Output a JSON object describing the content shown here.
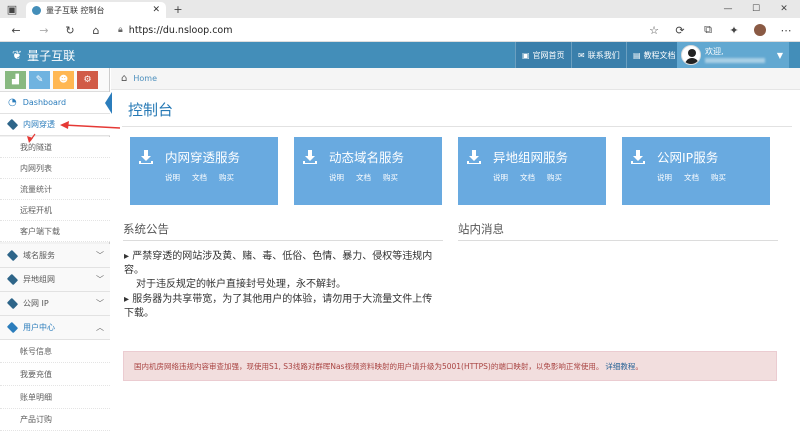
{
  "browser": {
    "tab_title": "量子互联 控制台",
    "url": "https://du.nsloop.com"
  },
  "navbar": {
    "brand": "量子互联",
    "links": [
      {
        "label": "官网首页",
        "icon": "monitor-icon"
      },
      {
        "label": "联系我们",
        "icon": "chat-icon"
      },
      {
        "label": "教程文档",
        "icon": "book-icon"
      }
    ],
    "user_greeting": "欢迎,"
  },
  "shortcuts": [
    {
      "icon": "signal-icon",
      "color": "#87b87f"
    },
    {
      "icon": "pencil-icon",
      "color": "#6fb3e0"
    },
    {
      "icon": "users-icon",
      "color": "#ffb752"
    },
    {
      "icon": "cogs-icon",
      "color": "#d15b47"
    }
  ],
  "sidebar": {
    "dashboard": "Dashboard",
    "nat_group": "内网穿透",
    "nat_items": [
      "我的隧道",
      "内网列表",
      "流量统计",
      "远程开机",
      "客户端下载"
    ],
    "domain": "域名服务",
    "vpn": "异地组网",
    "public_ip": "公网 IP",
    "user_center": "用户中心",
    "user_items": [
      "帐号信息",
      "我要充值",
      "账单明细",
      "产品订购"
    ]
  },
  "breadcrumb": {
    "home": "Home"
  },
  "page": {
    "title": "控制台",
    "cards": [
      {
        "title": "内网穿透服务",
        "links": [
          "说明",
          "文档",
          "购买"
        ]
      },
      {
        "title": "动态域名服务",
        "links": [
          "说明",
          "文档",
          "购买"
        ]
      },
      {
        "title": "异地组网服务",
        "links": [
          "说明",
          "文档",
          "购买"
        ]
      },
      {
        "title": "公网IP服务",
        "links": [
          "说明",
          "文档",
          "购买"
        ]
      }
    ],
    "announcement_title": "系统公告",
    "messages_title": "站内消息",
    "notices": [
      "严禁穿透的网站涉及黄、赌、毒、低俗、色情、暴力、侵权等违规内容。",
      "对于违反规定的帐户直接封号处理，永不解封。",
      "服务器为共享带宽，为了其他用户的体验，请勿用于大流量文件上传下载。"
    ],
    "alert_text": "国内机房网络违规内容审查加强，现使用S1, S3线路对群晖Nas视频资料映射的用户请升级为5001(HTTPS)的端口映射，以免影响正常使用。",
    "alert_link": "详细教程",
    "alert_end": "。"
  },
  "colors": {
    "navbar": "#438eb9",
    "card": "#69aae0",
    "title": "#2679b5",
    "alert_bg": "#f2dede",
    "annotation": "#e53935"
  }
}
